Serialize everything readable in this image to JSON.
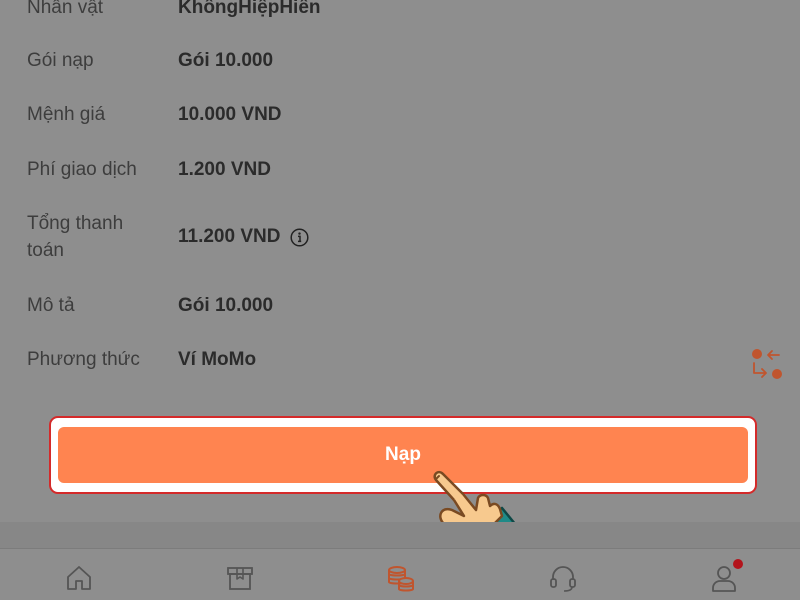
{
  "details": {
    "rows": [
      {
        "label": "Nhân vật",
        "value": "KhôngHiệpHiền"
      },
      {
        "label": "Gói nạp",
        "value": "Gói 10.000"
      },
      {
        "label": "Mệnh giá",
        "value": "10.000 VND"
      },
      {
        "label": "Phí giao dịch",
        "value": "1.200 VND"
      },
      {
        "label": "Tổng thanh toán",
        "value": "11.200 VND"
      },
      {
        "label": "Mô tả",
        "value": "Gói 10.000"
      },
      {
        "label": "Phương thức",
        "value": "Ví MoMo"
      }
    ]
  },
  "action": {
    "submit_label": "Nạp"
  },
  "nav": {
    "tabs": [
      {
        "icon": "home-icon"
      },
      {
        "icon": "box-icon"
      },
      {
        "icon": "coins-icon",
        "active": true
      },
      {
        "icon": "headset-icon"
      },
      {
        "icon": "user-icon",
        "has_badge": true
      }
    ]
  },
  "colors": {
    "accent": "#ff8450",
    "highlight_border": "#d42a2a",
    "active_tab": "#c0552e",
    "badge": "#b3141c"
  }
}
